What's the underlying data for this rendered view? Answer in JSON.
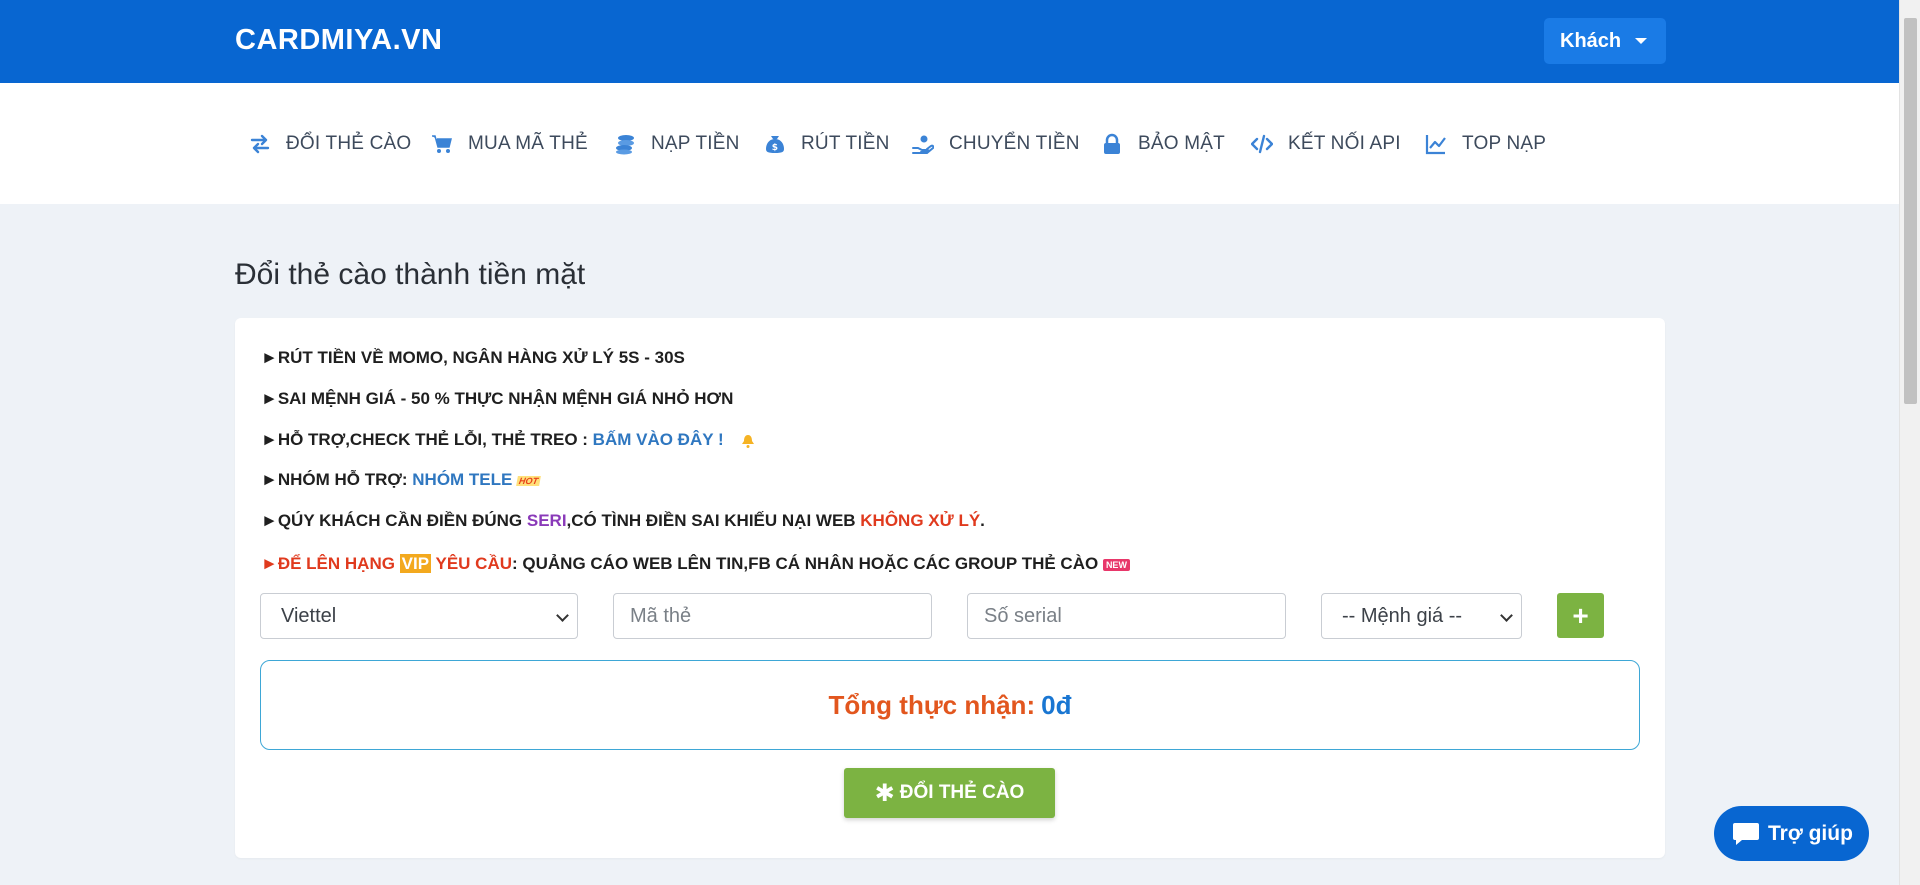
{
  "header": {
    "brand": "CARDMIYA.VN",
    "user_menu_label": "Khách"
  },
  "nav": [
    {
      "label": "ĐỔI THẺ CÀO",
      "icon": "exchange-icon"
    },
    {
      "label": "MUA MÃ THẺ",
      "icon": "cart-icon"
    },
    {
      "label": "NẠP TIỀN",
      "icon": "coins-icon"
    },
    {
      "label": "RÚT TIỀN",
      "icon": "money-bag-icon"
    },
    {
      "label": "CHUYỂN TIỀN",
      "icon": "hand-coin-icon"
    },
    {
      "label": "BẢO MẬT",
      "icon": "lock-icon"
    },
    {
      "label": "KẾT NỐI API",
      "icon": "code-icon"
    },
    {
      "label": "TOP NẠP",
      "icon": "chart-line-icon"
    }
  ],
  "page_title": "Đổi thẻ cào thành tiền mặt",
  "notes": {
    "n1": "►RÚT TIỀN VỀ MOMO, NGÂN HÀNG XỬ LÝ 5S - 30S",
    "n2": "►SAI MỆNH GIÁ - 50 % THỰC NHẬN MỆNH GIÁ NHỎ HƠN",
    "n3_prefix": "►HỖ TRỢ,CHECK THẺ LỖI, THẺ TREO : ",
    "n3_link": "BẤM VÀO ĐÂY !",
    "n4_prefix": "►NHÓM HỖ TRỢ: ",
    "n4_link": "NHÓM TELE",
    "n4_badge": "HOT",
    "n5_prefix": "►QÚY KHÁCH CẦN ĐIỀN ĐÚNG ",
    "n5_seri": "SERI",
    "n5_mid": ",CÓ TÌNH ĐIỀN SAI KHIẾU NẠI WEB ",
    "n5_warn": "KHÔNG XỬ LÝ",
    "n5_end": ".",
    "n6_arrow": "►",
    "n6_red1": "ĐỂ LÊN HẠNG ",
    "n6_vip": "VIP",
    "n6_red2": " YÊU CẦU",
    "n6_rest": ": QUẢNG CÁO WEB LÊN TIN,FB CÁ NHÂN HOẶC CÁC GROUP THẺ CÀO",
    "n6_badge": "NEW"
  },
  "form": {
    "telco_value": "Viettel",
    "code_placeholder": "Mã thẻ",
    "serial_placeholder": "Số serial",
    "amount_value": "-- Mệnh giá --",
    "add_label": "+"
  },
  "total": {
    "label": "Tổng thực nhận:",
    "value": "0đ"
  },
  "submit_label": "ĐỔI THẺ CÀO",
  "help_label": "Trợ giúp",
  "colors": {
    "primary": "#0866d1",
    "success": "#7cb342",
    "accent_red": "#e03a1e",
    "link_blue": "#2f77c0"
  }
}
